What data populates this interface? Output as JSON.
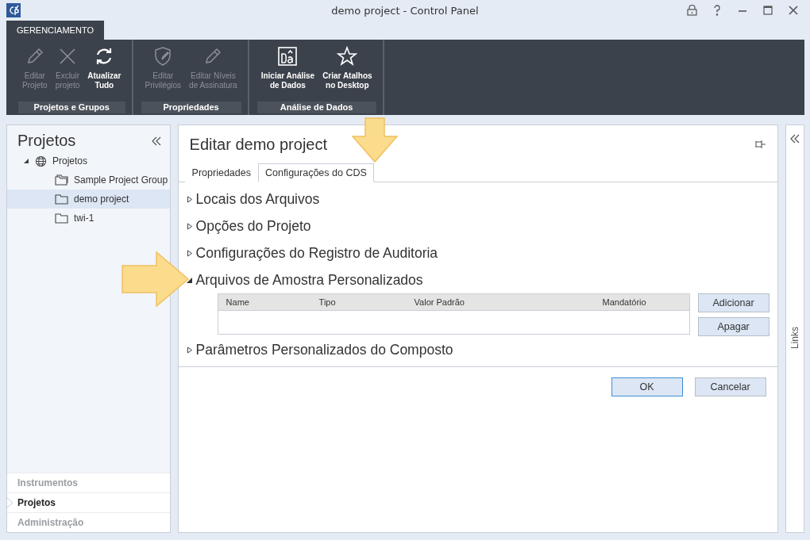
{
  "window": {
    "title": "demo project - Control Panel"
  },
  "ribbon": {
    "tab": {
      "label": "GERENCIAMENTO",
      "selected": true
    },
    "groups": [
      {
        "label": "Projetos e Grupos",
        "buttons": [
          {
            "label": "Editar\nProjeto",
            "disabled": true
          },
          {
            "label": "Excluir\nprojeto",
            "disabled": true
          },
          {
            "label": "Atualizar\nTudo",
            "disabled": false
          }
        ]
      },
      {
        "label": "Propriedades",
        "buttons": [
          {
            "label": "Editar\nPrivilégios",
            "disabled": true
          },
          {
            "label": "Editar Níveis\nde Assinatura",
            "disabled": true
          }
        ]
      },
      {
        "label": "Análise de Dados",
        "buttons": [
          {
            "label": "Iniciar Análise\nde Dados",
            "disabled": false
          },
          {
            "label": "Criar Atalhos\nno Desktop",
            "disabled": false
          }
        ]
      }
    ]
  },
  "sidebar": {
    "title": "Projetos",
    "tree": [
      {
        "label": "Projetos",
        "kind": "root",
        "expanded": true,
        "selected": false,
        "children": [
          {
            "label": "Sample Project Group",
            "kind": "group",
            "selected": false
          },
          {
            "label": "demo project",
            "kind": "project",
            "selected": true
          },
          {
            "label": "twi-1",
            "kind": "project",
            "selected": false
          }
        ]
      }
    ],
    "nav": [
      {
        "label": "Instrumentos",
        "selected": false
      },
      {
        "label": "Projetos",
        "selected": true
      },
      {
        "label": "Administração",
        "selected": false
      }
    ]
  },
  "content": {
    "title": "Editar demo project",
    "tabs": [
      {
        "label": "Propriedades",
        "selected": false
      },
      {
        "label": "Configurações do CDS",
        "selected": true
      }
    ],
    "sections": [
      {
        "label": "Locais dos Arquivos",
        "expanded": false
      },
      {
        "label": "Opções do Projeto",
        "expanded": false
      },
      {
        "label": "Configurações do Registro de Auditoria",
        "expanded": false
      },
      {
        "label": "Arquivos de Amostra Personalizados",
        "expanded": true,
        "table": {
          "columns": [
            "Name",
            "Tipo",
            "Valor Padrão",
            "Mandatório"
          ]
        },
        "buttons": [
          "Adicionar",
          "Apagar"
        ]
      },
      {
        "label": "Parâmetros Personalizados do Composto",
        "expanded": false
      }
    ],
    "footer_buttons": [
      {
        "label": "OK",
        "default": true
      },
      {
        "label": "Cancelar",
        "default": false
      }
    ]
  },
  "links_panel": {
    "label": "Links"
  }
}
